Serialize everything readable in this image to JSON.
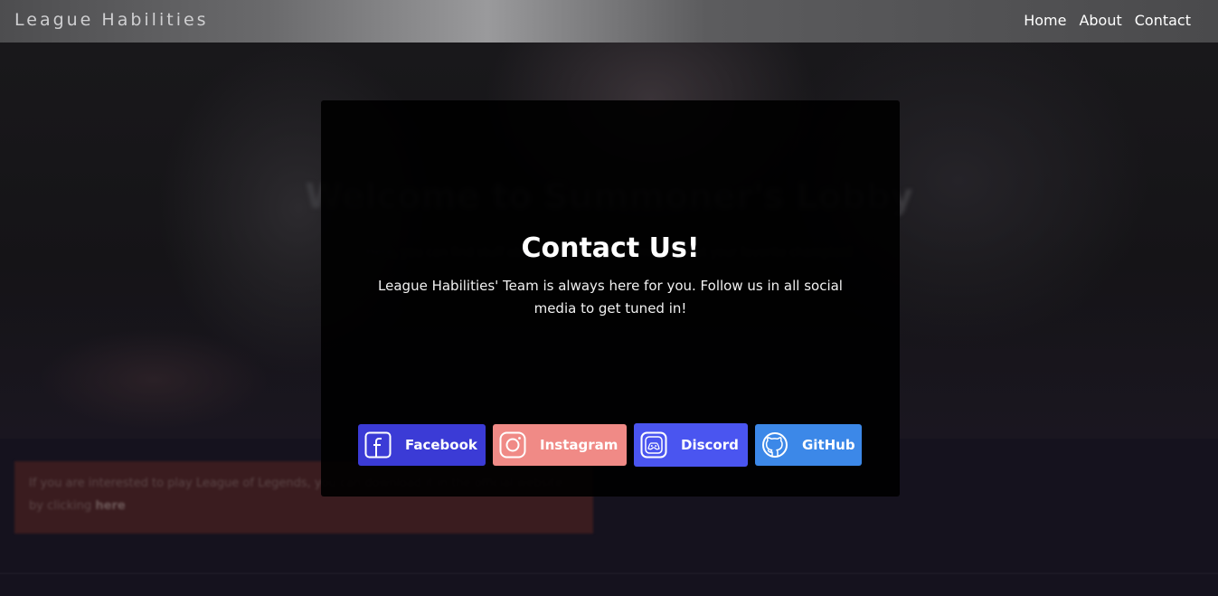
{
  "nav": {
    "brand": "League Habilities",
    "links": [
      "Home",
      "About",
      "Contact"
    ]
  },
  "hero": {
    "title": "Welcome to Summoner's Lobby",
    "subtitle": "Here, you can find stuff about champions and more about your favorite champion!"
  },
  "info_box": {
    "text": "If you are interested to play League of Legends, you can download it in the official website by clicking",
    "link": "here"
  },
  "modal": {
    "title": "Contact Us!",
    "text": "League Habilities' Team is always here for you. Follow us in all social media to get tuned in!",
    "buttons": [
      {
        "label": "Facebook",
        "icon": "facebook-icon",
        "color": "#3b3bd6"
      },
      {
        "label": "Instagram",
        "icon": "instagram-icon",
        "color": "#f08a86"
      },
      {
        "label": "Discord",
        "icon": "discord-icon",
        "color": "#4a55f0"
      },
      {
        "label": "GitHub",
        "icon": "github-icon",
        "color": "#3c88e8"
      }
    ]
  }
}
